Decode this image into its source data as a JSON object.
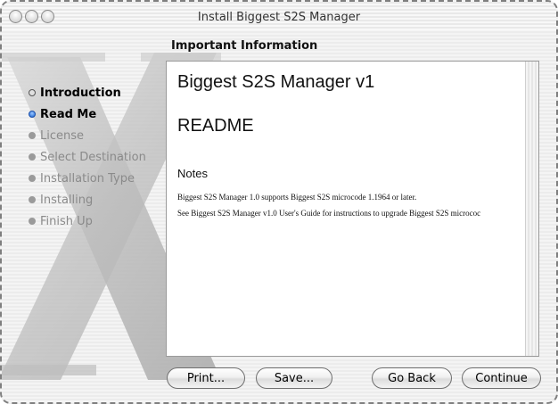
{
  "window": {
    "title": "Install Biggest S2S Manager"
  },
  "sidebar": {
    "steps": [
      {
        "label": "Introduction",
        "state": "done"
      },
      {
        "label": "Read Me",
        "state": "current"
      },
      {
        "label": "License",
        "state": "pending"
      },
      {
        "label": "Select Destination",
        "state": "pending"
      },
      {
        "label": "Installation Type",
        "state": "pending"
      },
      {
        "label": "Installing",
        "state": "pending"
      },
      {
        "label": "Finish Up",
        "state": "pending"
      }
    ]
  },
  "main": {
    "heading": "Important Information",
    "document": {
      "title": "Biggest S2S Manager v1",
      "readme": "README",
      "notes_heading": "Notes",
      "lines": [
        "Biggest S2S Manager 1.0 supports Biggest S2S microcode 1.1964 or later.",
        "See Biggest S2S Manager v1.0 User's Guide for instructions to upgrade Biggest S2S micrococ"
      ]
    }
  },
  "buttons": {
    "print": "Print...",
    "save": "Save...",
    "go_back": "Go Back",
    "continue": "Continue"
  },
  "colors": {
    "current_step_bullet": "#3b7fe0",
    "pending_step_text": "#8a8a8a"
  }
}
